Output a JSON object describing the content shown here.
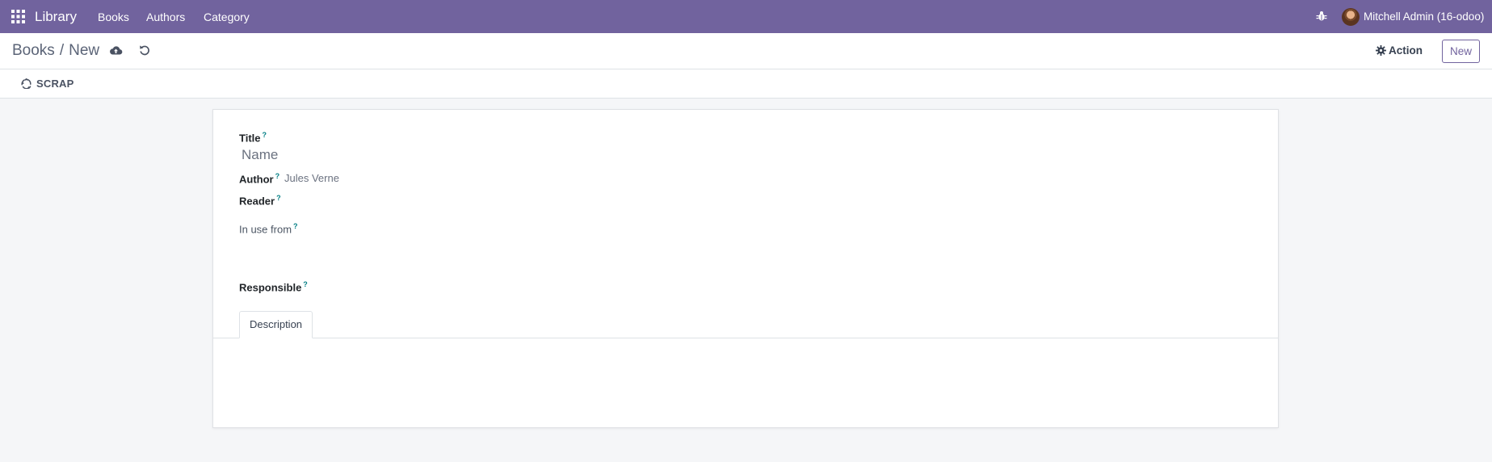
{
  "navbar": {
    "brand": "Library",
    "menu": [
      "Books",
      "Authors",
      "Category"
    ],
    "user": "Mitchell Admin (16-odoo)",
    "icons": [
      "apps-grid-icon",
      "bug-icon"
    ],
    "color": "#71639e"
  },
  "control_panel": {
    "breadcrumb": [
      "Books",
      "New"
    ],
    "breadcrumb_sep": "/",
    "action_label": "Action",
    "new_label": "New",
    "icons": [
      "cloud-upload-icon",
      "undo-icon",
      "gear-icon"
    ]
  },
  "button_bar": {
    "scrap_label": "SCRAP",
    "icons": [
      "recycle-icon"
    ]
  },
  "form": {
    "title_label": "Title",
    "title_placeholder": "Name",
    "author_label": "Author",
    "author_value": "Jules Verne",
    "reader_label": "Reader",
    "in_use_label": "In use from",
    "responsible_label": "Responsible",
    "help_mark": "?",
    "tabs": [
      "Description"
    ]
  }
}
